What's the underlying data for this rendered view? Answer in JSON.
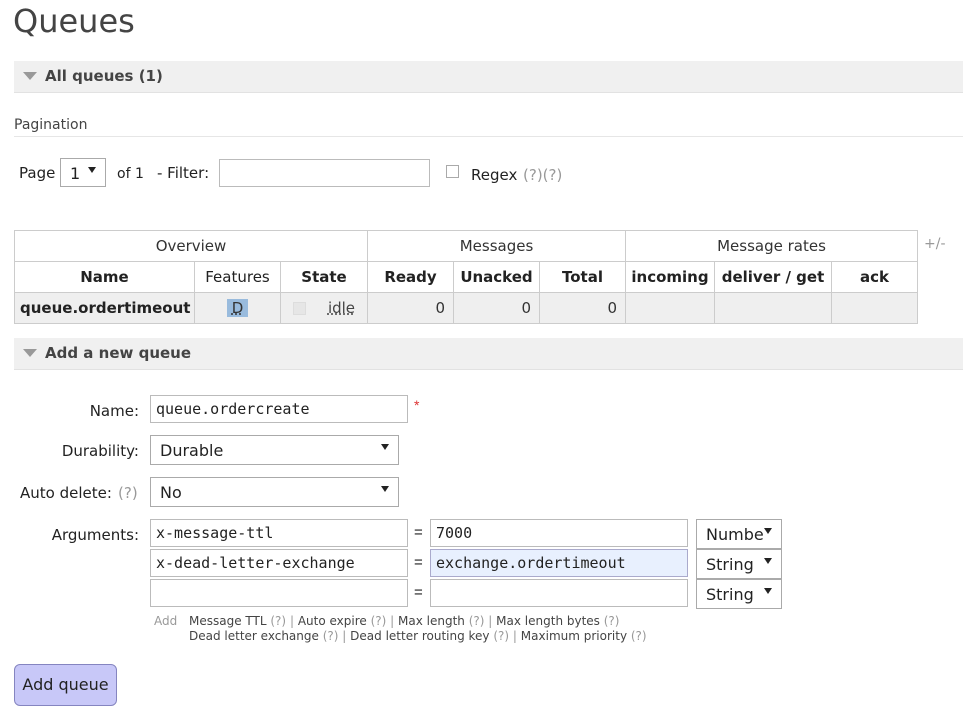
{
  "page_title": "Queues",
  "all_queues_section": {
    "label": "All queues (1)"
  },
  "pagination": {
    "label": "Pagination",
    "page_label": "Page",
    "page_value": "1",
    "of_label": "of 1",
    "filter_label": "- Filter:",
    "filter_value": "",
    "regex_label": "Regex",
    "regex_help": "(?)(?)"
  },
  "table": {
    "groups": [
      "Overview",
      "Messages",
      "Message rates"
    ],
    "plus_minus": "+/-",
    "columns": [
      "Name",
      "Features",
      "State",
      "Ready",
      "Unacked",
      "Total",
      "incoming",
      "deliver / get",
      "ack"
    ],
    "rows": [
      {
        "name": "queue.ordertimeout",
        "feature": "D",
        "state": "idle",
        "ready": "0",
        "unacked": "0",
        "total": "0",
        "incoming": "",
        "deliver_get": "",
        "ack": ""
      }
    ]
  },
  "add_section": {
    "label": "Add a new queue"
  },
  "form": {
    "name_label": "Name:",
    "name_value": "queue.ordercreate",
    "required_mark": "*",
    "durability_label": "Durability:",
    "durability_value": "Durable",
    "auto_delete_label": "Auto delete:",
    "auto_delete_help": "(?)",
    "auto_delete_value": "No",
    "arguments_label": "Arguments:",
    "eq": "=",
    "arguments": [
      {
        "key": "x-message-ttl",
        "value": "7000",
        "type": "Numbe"
      },
      {
        "key": "x-dead-letter-exchange",
        "value": "exchange.ordertimeout",
        "type": "String"
      },
      {
        "key": "",
        "value": "",
        "type": "String"
      }
    ],
    "add_label": "Add",
    "shortcuts_line1": [
      {
        "text": "Message TTL",
        "help": "(?)"
      },
      {
        "text": "Auto expire",
        "help": "(?)"
      },
      {
        "text": "Max length",
        "help": "(?)"
      },
      {
        "text": "Max length bytes",
        "help": "(?)"
      }
    ],
    "shortcuts_line2": [
      {
        "text": "Dead letter exchange",
        "help": "(?)"
      },
      {
        "text": "Dead letter routing key",
        "help": "(?)"
      },
      {
        "text": "Maximum priority",
        "help": "(?)"
      }
    ],
    "separator": "|",
    "submit_label": "Add queue"
  }
}
